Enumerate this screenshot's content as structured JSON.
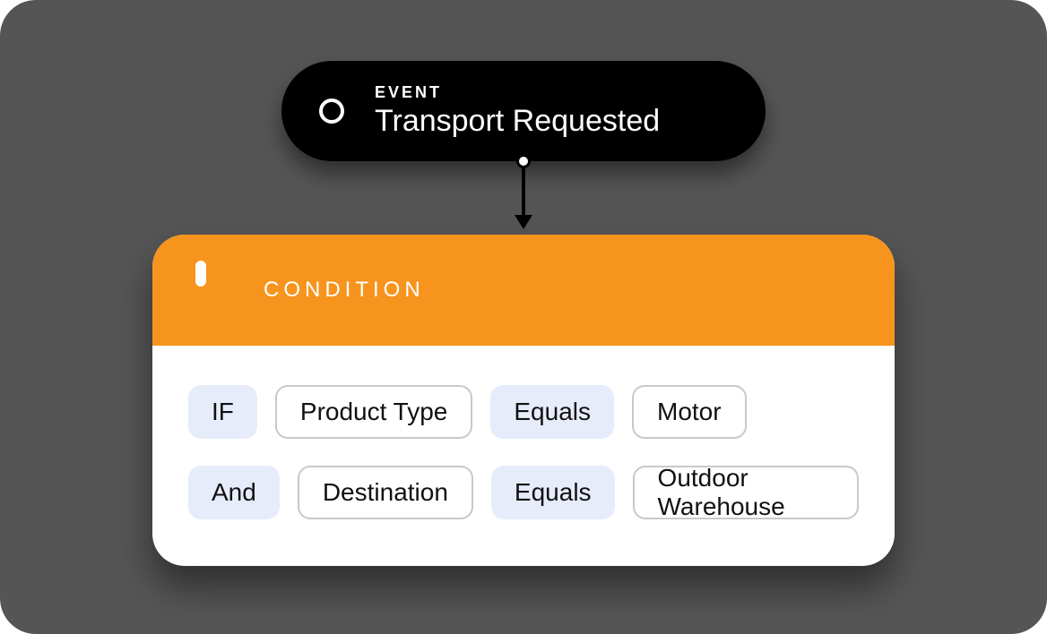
{
  "event": {
    "label": "EVENT",
    "title": "Transport Requested"
  },
  "condition": {
    "label": "CONDITION",
    "rows": [
      {
        "connector": "IF",
        "field": "Product Type",
        "operator": "Equals",
        "value": "Motor"
      },
      {
        "connector": "And",
        "field": "Destination",
        "operator": "Equals",
        "value": "Outdoor Warehouse"
      }
    ]
  },
  "colors": {
    "canvas": "#555556",
    "event_bg": "#000000",
    "condition_header": "#F7941D",
    "keyword_chip": "#E7ECFB"
  }
}
